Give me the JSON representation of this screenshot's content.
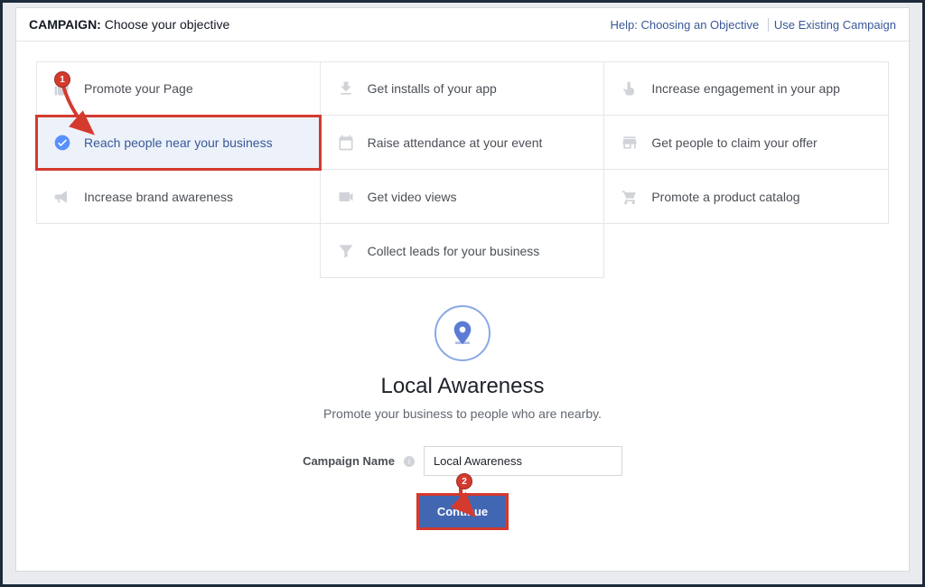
{
  "header": {
    "campaign_label": "CAMPAIGN:",
    "subtitle": "Choose your objective",
    "help_link": "Help: Choosing an Objective",
    "existing_link": "Use Existing Campaign"
  },
  "objectives": {
    "row1": {
      "promote_page": "Promote your Page",
      "app_installs": "Get installs of your app",
      "app_engagement": "Increase engagement in your app"
    },
    "row2": {
      "reach_nearby": "Reach people near your business",
      "event_attendance": "Raise attendance at your event",
      "claim_offer": "Get people to claim your offer"
    },
    "row3": {
      "brand_awareness": "Increase brand awareness",
      "video_views": "Get video views",
      "product_catalog": "Promote a product catalog"
    },
    "row4": {
      "collect_leads": "Collect leads for your business"
    }
  },
  "detail": {
    "title": "Local Awareness",
    "subtitle": "Promote your business to people who are nearby.",
    "name_label": "Campaign Name",
    "name_value": "Local Awareness",
    "continue_label": "Continue"
  },
  "callouts": {
    "one": "1",
    "two": "2"
  }
}
